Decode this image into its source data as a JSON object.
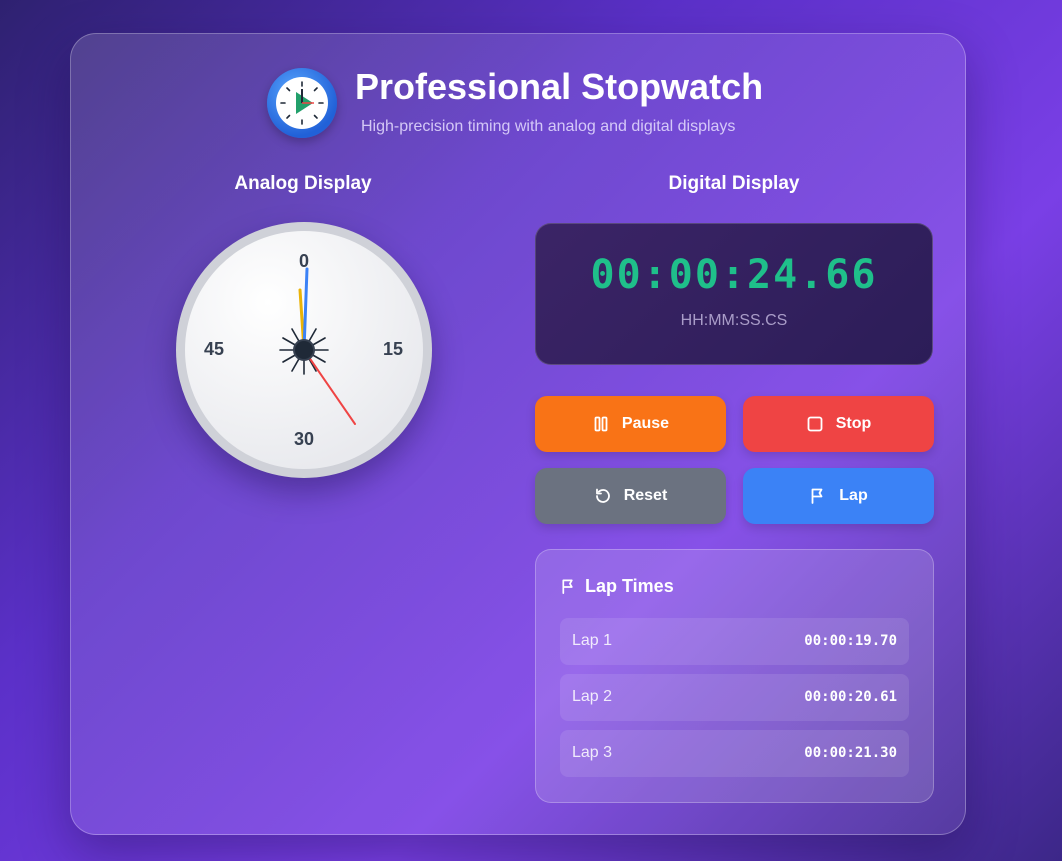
{
  "header": {
    "title": "Professional Stopwatch",
    "subtitle": "High-precision timing with analog and digital displays",
    "icon": "stopwatch-play-icon"
  },
  "analog": {
    "title": "Analog Display",
    "labels": {
      "top": "0",
      "right": "15",
      "bottom": "30",
      "left": "45"
    },
    "seconds": 24.66
  },
  "digital": {
    "title": "Digital Display",
    "time": "00:00:24.66",
    "format": "HH:MM:SS.CS",
    "color": "#1fbf8a"
  },
  "controls": {
    "pause": {
      "label": "Pause",
      "icon": "pause-icon",
      "color": "#f97316"
    },
    "stop": {
      "label": "Stop",
      "icon": "stop-icon",
      "color": "#ef4444"
    },
    "reset": {
      "label": "Reset",
      "icon": "reset-icon",
      "color": "#6b7280"
    },
    "lap": {
      "label": "Lap",
      "icon": "flag-icon",
      "color": "#3b82f6"
    }
  },
  "laps": {
    "title": "Lap Times",
    "items": [
      {
        "name": "Lap 1",
        "time": "00:00:19.70"
      },
      {
        "name": "Lap 2",
        "time": "00:00:20.61"
      },
      {
        "name": "Lap 3",
        "time": "00:00:21.30"
      }
    ]
  }
}
